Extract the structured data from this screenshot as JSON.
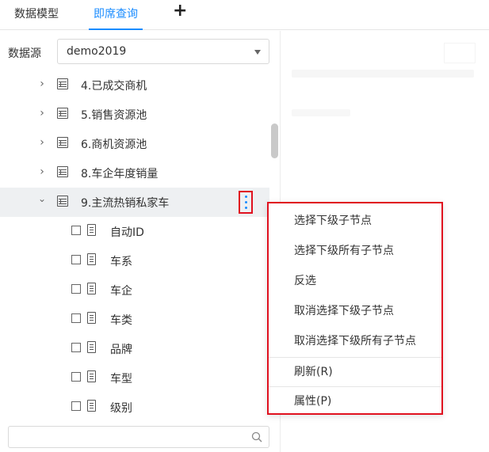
{
  "tabs": {
    "items": [
      "数据模型",
      "即席查询"
    ],
    "active_index": 1,
    "add_icon": "plus-icon"
  },
  "datasource": {
    "label": "数据源",
    "value": "demo2019"
  },
  "tree": {
    "tables": [
      {
        "label": "4.已成交商机",
        "expanded": false
      },
      {
        "label": "5.销售资源池",
        "expanded": false
      },
      {
        "label": "6.商机资源池",
        "expanded": false
      },
      {
        "label": "8.车企年度销量",
        "expanded": false
      },
      {
        "label": "9.主流热销私家车",
        "expanded": true,
        "selected": true
      }
    ],
    "fields": [
      "自动ID",
      "车系",
      "车企",
      "车类",
      "品牌",
      "车型",
      "级别"
    ]
  },
  "search": {
    "placeholder": "",
    "value": ""
  },
  "context_menu": {
    "items": [
      "选择下级子节点",
      "选择下级所有子节点",
      "反选",
      "取消选择下级子节点",
      "取消选择下级所有子节点"
    ],
    "refresh": "刷新(R)",
    "properties": "属性(P)"
  },
  "colors": {
    "accent": "#1a8cff",
    "highlight_border": "#e0111f",
    "selected_row_bg": "#eef0f2"
  }
}
